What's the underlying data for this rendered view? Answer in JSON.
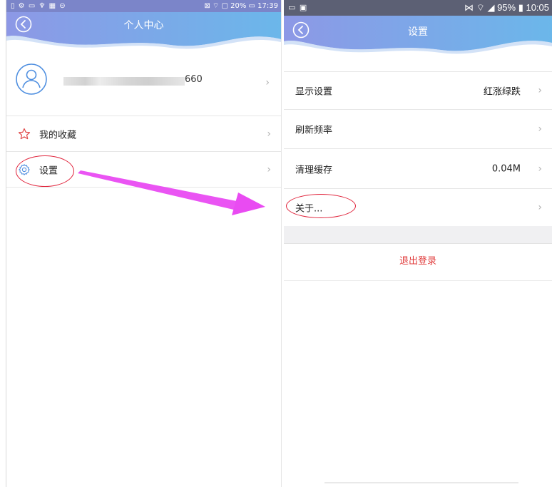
{
  "left": {
    "status_left": "▯ ⚙ ▭ ♆ ▦ ⊝",
    "status_right": "⊠ ⌔ ▢ 20% ▭ 17:39",
    "title": "个人中心",
    "profile_number": "660",
    "rows": [
      {
        "label": "我的收藏",
        "icon": "star-icon"
      },
      {
        "label": "设置",
        "icon": "gear-icon"
      }
    ]
  },
  "right": {
    "status_left": "▭ ▣",
    "status_right": "⋈ ⌔ ◢ 95% ▮ 10:05",
    "title": "设置",
    "rows": [
      {
        "label": "显示设置",
        "value": "红涨绿跌"
      },
      {
        "label": "刷新频率",
        "value": ""
      },
      {
        "label": "清理缓存",
        "value": "0.04M"
      },
      {
        "label": "关于...",
        "value": ""
      }
    ],
    "logout_label": "退出登录"
  },
  "colors": {
    "header_gradient_start": "#8d98e6",
    "header_gradient_end": "#6bb7ea",
    "annotation_red": "#e0223a",
    "annotation_arrow": "#e94bf2",
    "logout_red": "#e03a3a"
  }
}
